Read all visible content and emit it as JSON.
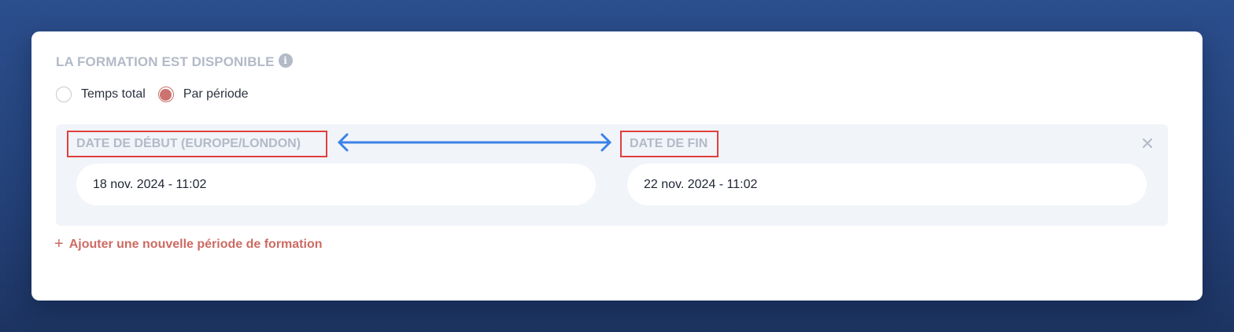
{
  "section": {
    "title": "LA FORMATION EST DISPONIBLE",
    "info_icon": "info-icon"
  },
  "availability": {
    "options": [
      {
        "label": "Temps total",
        "checked": false
      },
      {
        "label": "Par période",
        "checked": true
      }
    ]
  },
  "period": {
    "start_label": "DATE DE DÉBUT (EUROPE/LONDON)",
    "end_label": "DATE DE FIN",
    "start_value": "18 nov. 2024 - 11:02",
    "end_value": "22 nov. 2024 - 11:02"
  },
  "add_period": {
    "label": "Ajouter une nouvelle période de formation",
    "icon": "plus-icon"
  },
  "colors": {
    "background": "#2b4e8c",
    "accent": "#cc7370",
    "muted_label": "#b3bac7",
    "annotation_box": "#e0403f",
    "annotation_arrow": "#3b82e8",
    "panel": "#f1f4f9"
  }
}
